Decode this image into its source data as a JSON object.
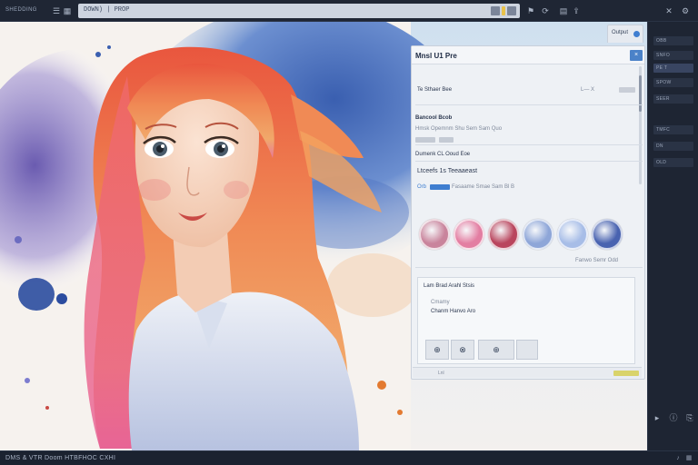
{
  "topbar": {
    "brand": "SHEDDING",
    "url": "DOWN) | PROP"
  },
  "panel": {
    "tab_label": "Output",
    "title": "Mnsl  U1 Pre",
    "close": "×",
    "row1_label": "Te  Sthaer  Bee",
    "row1_value": "L— X",
    "section1_title": "Bancool  Bcob",
    "section1_line": "Hmsk  Opemnm  Shu  Sem  Sam  Quo",
    "section2_title": "Dumenk  CL  Ooud  Eoe",
    "section3_title": "Ltceefs  1s  Teeaaeast",
    "section3_tag": "Orb",
    "section3_line": "Fasaame  Smae  Sam  Bl  B",
    "swatch_caption": "Fanwo  Semr  Odd",
    "lower_label": "Lam  Brad  Arahl  Stsis",
    "lower_line1": "Cmamy",
    "lower_line2": "Chanm  Hanvo  Aro",
    "btn1": "⊕",
    "btn2": "⊗",
    "btn3": "⊕",
    "footer_text": "Lnl"
  },
  "colors": {
    "swatches": [
      "#c9849c",
      "#e37ea2",
      "#b9455d",
      "#8ea6d8",
      "#a7bde7",
      "#4963b0"
    ],
    "accent": "#4b82c8"
  },
  "sidebar": {
    "items": [
      {
        "label": "OBB"
      },
      {
        "label": "SNFO"
      },
      {
        "label": "PE T"
      },
      {
        "label": "SPOW"
      },
      {
        "label": "SEER"
      },
      {
        "label": "TMFC"
      },
      {
        "label": "DN"
      },
      {
        "label": "OLD"
      }
    ]
  },
  "status": {
    "text": "DMS  &  VTR   Doom  HTBFHOC  CXHI"
  }
}
